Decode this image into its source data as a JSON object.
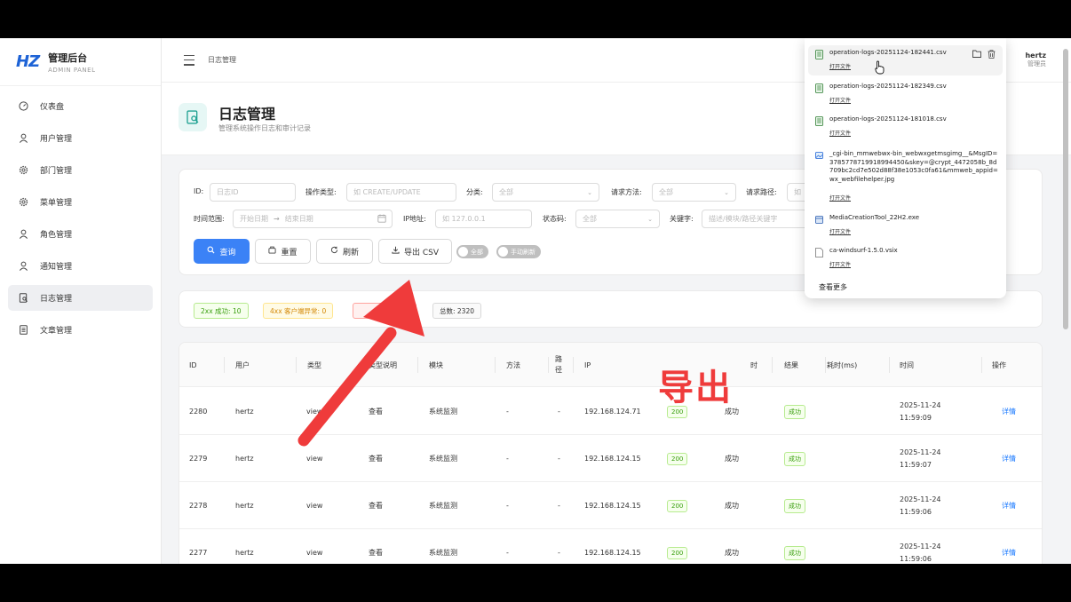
{
  "app": {
    "logo_mark": "HZ",
    "title": "管理后台",
    "subtitle": "ADMIN PANEL"
  },
  "sidebar": {
    "items": [
      {
        "label": "仪表盘",
        "icon": "dashboard-icon"
      },
      {
        "label": "用户管理",
        "icon": "user-icon"
      },
      {
        "label": "部门管理",
        "icon": "gear-icon"
      },
      {
        "label": "菜单管理",
        "icon": "gear-icon"
      },
      {
        "label": "角色管理",
        "icon": "user-icon"
      },
      {
        "label": "通知管理",
        "icon": "user-icon"
      },
      {
        "label": "日志管理",
        "icon": "log-search-icon",
        "active": true
      },
      {
        "label": "文章管理",
        "icon": "article-icon"
      }
    ]
  },
  "topbar": {
    "breadcrumb": "日志管理",
    "user_name": "hertz",
    "user_role": "管理员"
  },
  "page": {
    "title": "日志管理",
    "description": "管理系统操作日志和审计记录"
  },
  "filters": {
    "id_label": "ID:",
    "id_placeholder": "日志ID",
    "op_type_label": "操作类型:",
    "op_type_placeholder": "如 CREATE/UPDATE",
    "category_label": "分类:",
    "category_value": "全部",
    "method_label": "请求方法:",
    "method_value": "全部",
    "path_label": "请求路径:",
    "path_placeholder": "如",
    "time_label": "时间范围:",
    "start_placeholder": "开始日期",
    "end_placeholder": "结束日期",
    "ip_label": "IP地址:",
    "ip_placeholder": "如 127.0.0.1",
    "status_label": "状态码:",
    "status_value": "全部",
    "keyword_label": "关键字:",
    "keyword_placeholder": "描述/模块/路径关键字"
  },
  "buttons": {
    "query": "查询",
    "reset": "重置",
    "refresh": "刷新",
    "export": "导出 CSV",
    "all_switch": "全部",
    "manual_refresh": "手动刷新"
  },
  "stats": {
    "ok": "2xx 成功: 10",
    "client_err": "4xx 客户端异常: 0",
    "server_err_fragment": "0",
    "total": "总数: 2320"
  },
  "table": {
    "headers": [
      "ID",
      "用户",
      "类型",
      "类型说明",
      "模块",
      "方法",
      "路径",
      "IP",
      "",
      "结果",
      "耗时(ms)",
      "时间",
      "操作"
    ],
    "header_tail": "时",
    "rows": [
      {
        "id": "2280",
        "user": "hertz",
        "type": "view",
        "type_desc": "查看",
        "module": "系统监测",
        "method": "-",
        "path": "-",
        "ip": "192.168.124.71",
        "status": "200",
        "status_text": "成功",
        "result": "成功",
        "date": "2025-11-24",
        "time": "11:59:09",
        "action": "详情"
      },
      {
        "id": "2279",
        "user": "hertz",
        "type": "view",
        "type_desc": "查看",
        "module": "系统监测",
        "method": "-",
        "path": "-",
        "ip": "192.168.124.15",
        "status": "200",
        "status_text": "成功",
        "result": "成功",
        "date": "2025-11-24",
        "time": "11:59:07",
        "action": "详情"
      },
      {
        "id": "2278",
        "user": "hertz",
        "type": "view",
        "type_desc": "查看",
        "module": "系统监测",
        "method": "-",
        "path": "-",
        "ip": "192.168.124.15",
        "status": "200",
        "status_text": "成功",
        "result": "成功",
        "date": "2025-11-24",
        "time": "11:59:06",
        "action": "详情"
      },
      {
        "id": "2277",
        "user": "hertz",
        "type": "view",
        "type_desc": "查看",
        "module": "系统监测",
        "method": "-",
        "path": "-",
        "ip": "192.168.124.15",
        "status": "200",
        "status_text": "成功",
        "result": "成功",
        "date": "2025-11-24",
        "time": "11:59:06",
        "action": "详情"
      }
    ]
  },
  "downloads": {
    "items": [
      {
        "name": "operation-logs-20251124-182441.csv",
        "open": "打开文件",
        "kind": "csv"
      },
      {
        "name": "operation-logs-20251124-182349.csv",
        "open": "打开文件",
        "kind": "csv"
      },
      {
        "name": "operation-logs-20251124-181018.csv",
        "open": "打开文件",
        "kind": "csv"
      },
      {
        "name": "_cgi-bin_mmwebwx-bin_webwxgetmsgimg__&MsgID=3785778719918994450&skey=@crypt_4472058b_8d709bc2cd7e502d88f38e1053c0fa61&mmweb_appid=wx_webfilehelper.jpg",
        "open": "打开文件",
        "kind": "image"
      },
      {
        "name": "MediaCreationTool_22H2.exe",
        "open": "打开文件",
        "kind": "exe"
      },
      {
        "name": "ca-windsurf-1.5.0.vsix",
        "open": "打开文件",
        "kind": "file"
      }
    ],
    "more": "查看更多"
  },
  "annotation": {
    "text": "导出",
    "color": "#ef3b3b"
  },
  "colors": {
    "primary": "#3b82f6",
    "success": "#389e0d",
    "warning": "#d48806",
    "danger": "#cf1322",
    "annotation": "#ef3b3b"
  }
}
